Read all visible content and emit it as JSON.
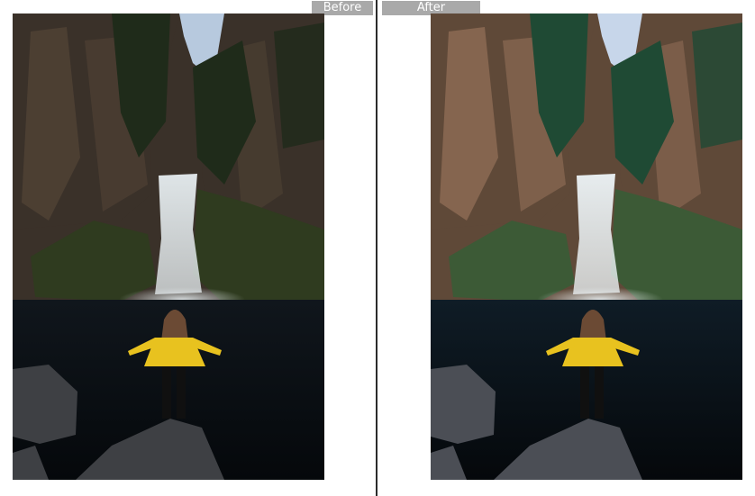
{
  "labels": {
    "before": "Before",
    "after": "After"
  },
  "colors": {
    "tab_bg": "#a9a9a9",
    "tab_text": "#ffffff",
    "divider": "#2b2b2b",
    "jacket": "#e8c21f"
  },
  "panels": [
    {
      "id": "before",
      "sky": "#b7c9de",
      "cliff": "#3a3129",
      "cliff_light": "#5b4a3a",
      "moss": "#2f3b1f",
      "foliage": "#1f2b1a",
      "water": "#10161c",
      "rock": "#3e4044",
      "falls": "#e7eef1"
    },
    {
      "id": "after",
      "sky": "#c7d6ea",
      "cliff": "#5f4938",
      "cliff_light": "#a47c63",
      "moss": "#3c5a36",
      "foliage": "#1f4a34",
      "water": "#0f1c26",
      "rock": "#4b4e55",
      "falls": "#eef5f8"
    }
  ]
}
